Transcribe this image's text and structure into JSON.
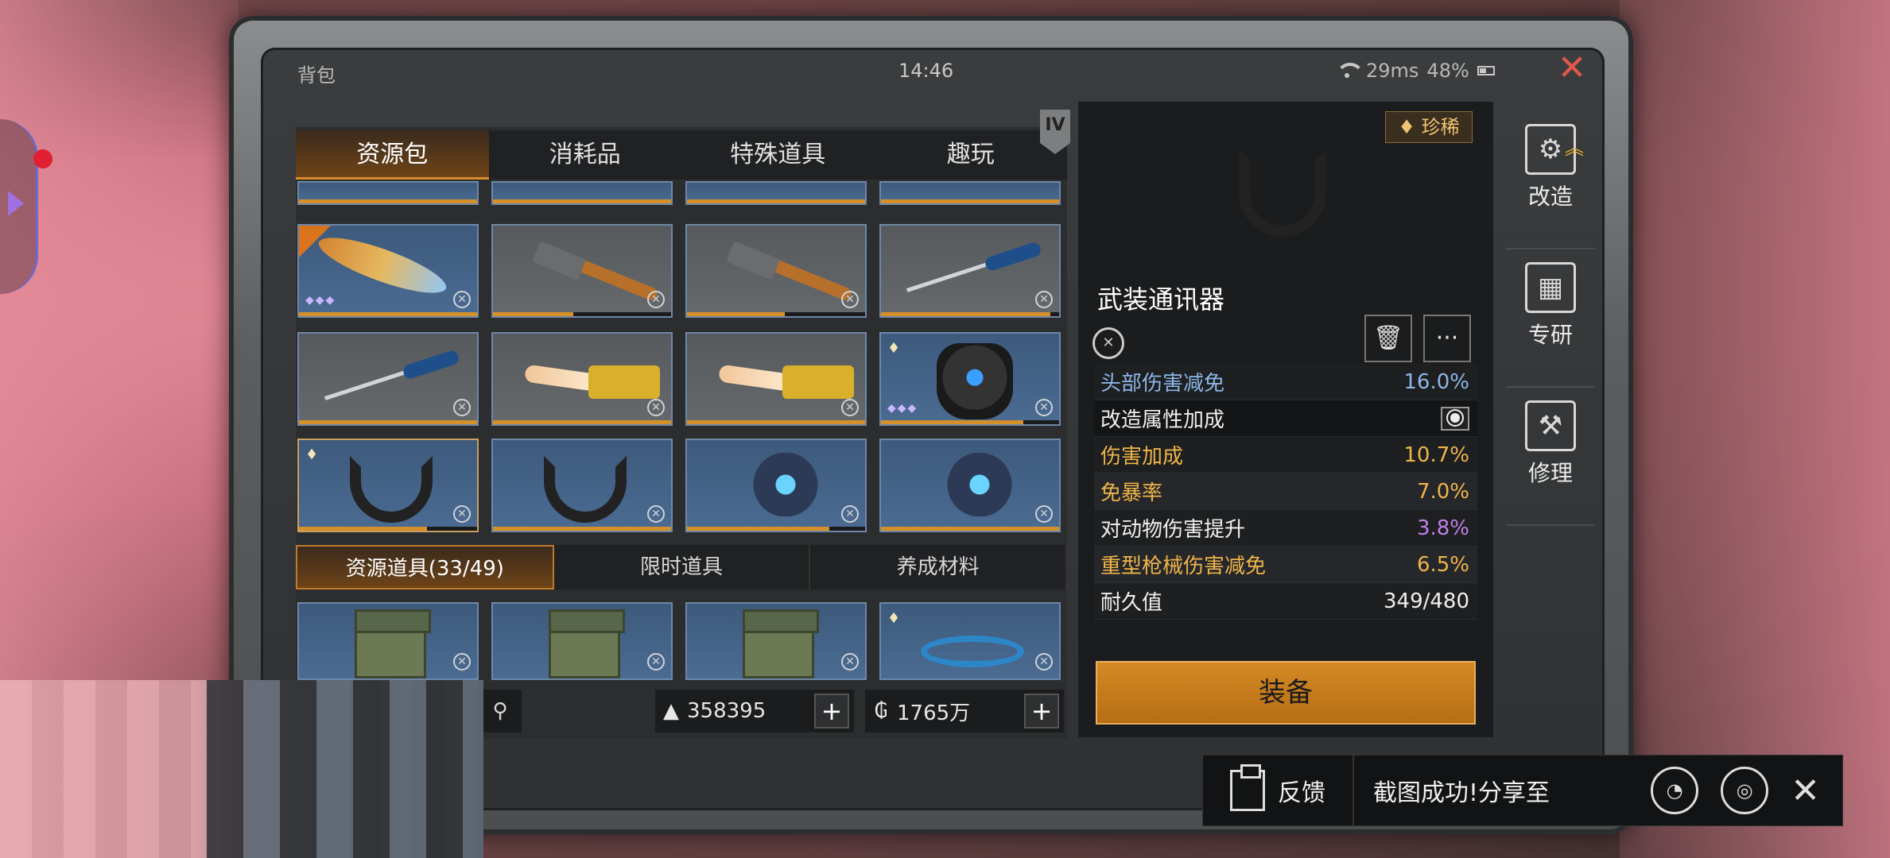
{
  "status_bar": {
    "title": "背包",
    "time": "14:46",
    "ping": "29ms",
    "battery": "48%"
  },
  "tabs": [
    {
      "label": "资源包",
      "active": true
    },
    {
      "label": "消耗品",
      "active": false
    },
    {
      "label": "特殊道具",
      "active": false
    },
    {
      "label": "趣玩",
      "active": false
    }
  ],
  "tier_badge": "IV",
  "grid_items": [
    {
      "kind": "flame",
      "bg": "blue",
      "stars": "◆◆◆",
      "durability": 1.0
    },
    {
      "kind": "hammer",
      "bg": "grey",
      "durability": 0.45
    },
    {
      "kind": "hammer",
      "bg": "grey",
      "durability": 0.55
    },
    {
      "kind": "screwdriver",
      "bg": "grey",
      "durability": 0.95
    },
    {
      "kind": "screwdriver",
      "bg": "grey",
      "durability": 1.0
    },
    {
      "kind": "chainsaw",
      "bg": "grey",
      "durability": 1.0
    },
    {
      "kind": "chainsaw",
      "bg": "grey",
      "durability": 1.0
    },
    {
      "kind": "armor",
      "bg": "blue",
      "stars": "◆◆◆",
      "gem": true,
      "durability": 0.8
    },
    {
      "kind": "collar",
      "bg": "blue",
      "gem": true,
      "durability": 0.72
    },
    {
      "kind": "collar",
      "bg": "blue",
      "durability": 1.0
    },
    {
      "kind": "mech",
      "bg": "blue",
      "durability": 0.8
    },
    {
      "kind": "mech",
      "bg": "blue",
      "durability": 1.0
    }
  ],
  "subtabs": [
    {
      "label": "资源道具(33/49)",
      "active": true
    },
    {
      "label": "限时道具",
      "active": false
    },
    {
      "label": "养成材料",
      "active": false
    }
  ],
  "lower_items": [
    {
      "kind": "box",
      "bg": "blue"
    },
    {
      "kind": "box",
      "bg": "blue"
    },
    {
      "kind": "box",
      "bg": "blue"
    },
    {
      "kind": "glider",
      "bg": "blue",
      "gem": true
    }
  ],
  "currency": {
    "gold_value": "358395",
    "coin_value": "1765万",
    "plus": "+"
  },
  "detail": {
    "rarity": "珍稀",
    "name": "武装通讯器",
    "stats": [
      {
        "label": "头部伤害减免",
        "value": "16.0%",
        "color": "blue"
      },
      {
        "label": "改造属性加成",
        "value": "",
        "section": true
      },
      {
        "label": "伤害加成",
        "value": "10.7%",
        "color": "gold"
      },
      {
        "label": "免暴率",
        "value": "7.0%",
        "color": "gold"
      },
      {
        "label": "对动物伤害提升",
        "value": "3.8%",
        "color": "purple"
      },
      {
        "label": "重型枪械伤害减免",
        "value": "6.5%",
        "color": "gold"
      },
      {
        "label": "耐久值",
        "value": "349/480",
        "color": "white"
      }
    ],
    "equip_label": "装备"
  },
  "side_actions": [
    {
      "label": "改造",
      "icon": "wrench-gear-icon"
    },
    {
      "label": "专研",
      "icon": "blueprint-icon"
    },
    {
      "label": "修理",
      "icon": "hammer-icon"
    }
  ],
  "toast": {
    "feedback_label": "反馈",
    "share_text": "截图成功!分享至"
  }
}
